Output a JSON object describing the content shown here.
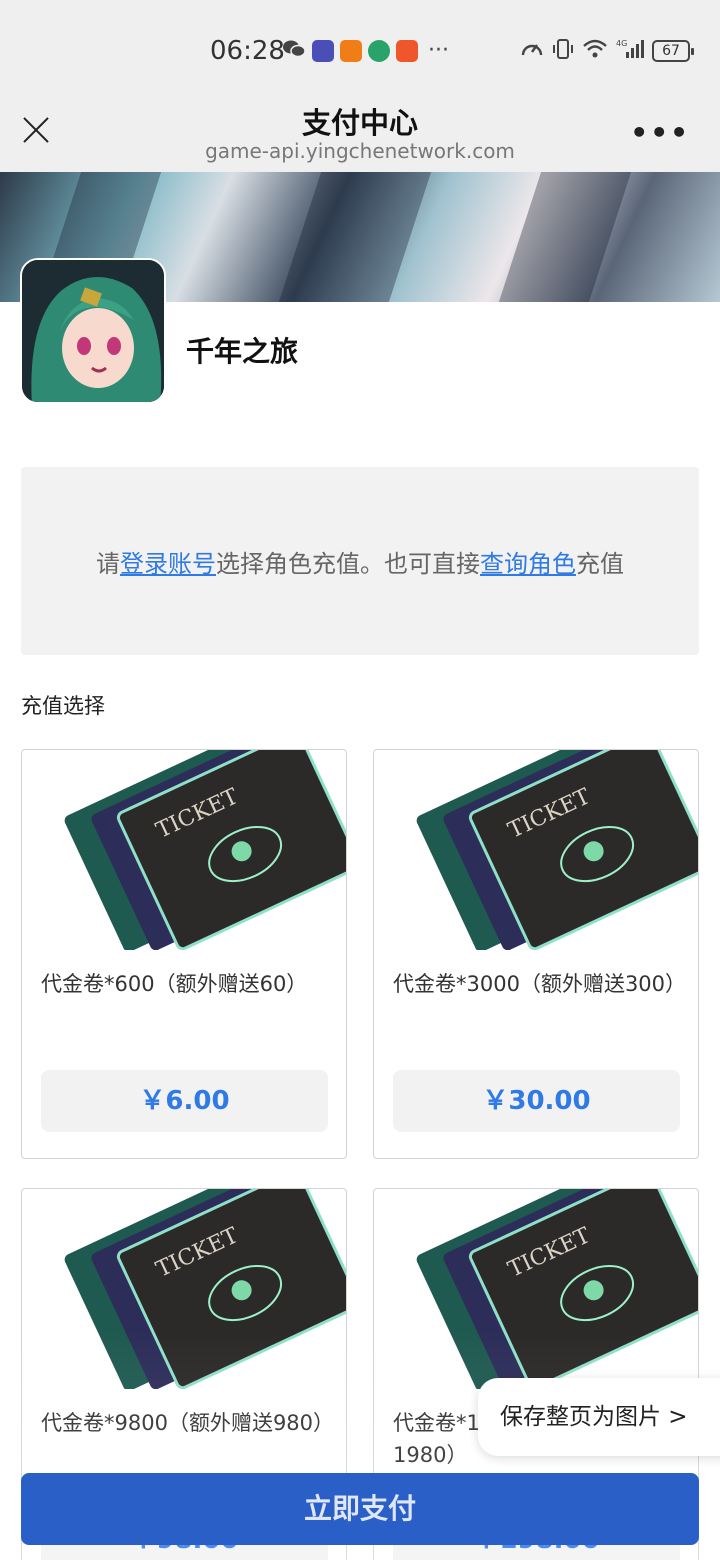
{
  "status_bar": {
    "time": "06:28",
    "more": "···",
    "battery": "67",
    "network": "4G"
  },
  "nav": {
    "title": "支付中心",
    "url": "game-api.yingchenetwork.com",
    "more": "•••"
  },
  "game": {
    "name": "千年之旅"
  },
  "login_prompt": {
    "prefix": "请",
    "login_link": "登录账号",
    "middle": "选择角色充值。也可直接",
    "query_link": "查询角色",
    "suffix": "充值"
  },
  "section_label": "充值选择",
  "products": [
    {
      "title": "代金卷*600（额外赠送60）",
      "price": "￥6.00"
    },
    {
      "title": "代金卷*3000（额外赠送300）",
      "price": "￥30.00"
    },
    {
      "title": "代金卷*9800（额外赠送980）",
      "price": "￥98.00"
    },
    {
      "title": "代金卷*19800（额外赠送1980）",
      "price": "￥198.00"
    }
  ],
  "ticket_text": "TICKET",
  "save_page": "保存整页为图片 >",
  "pay_button": "立即支付",
  "colors": {
    "link": "#2f7ae5",
    "pay_button": "#2a5fc7",
    "price": "#2f7ae5",
    "bar_bg": "#efefef"
  }
}
